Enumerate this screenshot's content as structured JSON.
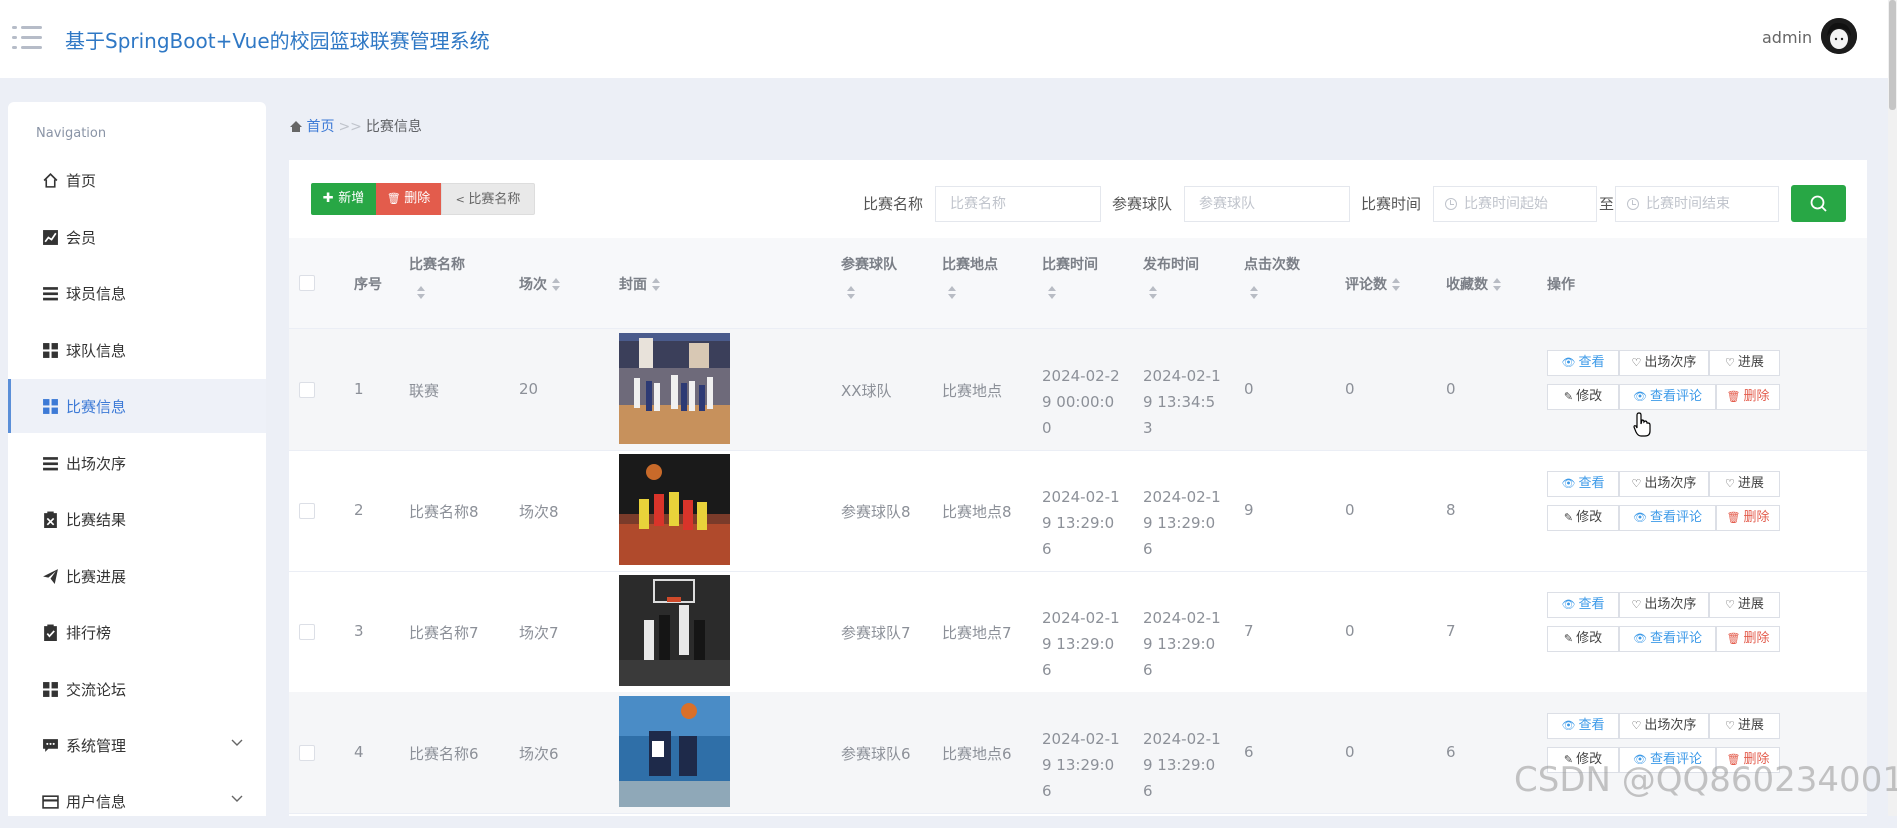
{
  "header": {
    "title": "基于SpringBoot+Vue的校园篮球联赛管理系统",
    "user": "admin"
  },
  "sidebar": {
    "title": "Navigation",
    "items": [
      {
        "label": "首页",
        "icon": "home-icon"
      },
      {
        "label": "会员",
        "icon": "chart-icon"
      },
      {
        "label": "球员信息",
        "icon": "list-icon"
      },
      {
        "label": "球队信息",
        "icon": "grid-icon"
      },
      {
        "label": "比赛信息",
        "icon": "grid-icon"
      },
      {
        "label": "出场次序",
        "icon": "list-icon"
      },
      {
        "label": "比赛结果",
        "icon": "clipboard-x-icon"
      },
      {
        "label": "比赛进展",
        "icon": "paper-plane-icon"
      },
      {
        "label": "排行榜",
        "icon": "clipboard-check-icon"
      },
      {
        "label": "交流论坛",
        "icon": "grid-icon"
      },
      {
        "label": "系统管理",
        "icon": "chat-icon"
      },
      {
        "label": "用户信息",
        "icon": "card-icon"
      }
    ]
  },
  "breadcrumb": {
    "home": "首页",
    "sep": ">>",
    "current": "比赛信息"
  },
  "toolbar": {
    "add": "新增",
    "delete": "删除",
    "share": "比赛名称"
  },
  "search": {
    "name_label": "比赛名称",
    "name_placeholder": "比赛名称",
    "team_label": "参赛球队",
    "team_placeholder": "参赛球队",
    "time_label": "比赛时间",
    "time_start_placeholder": "比赛时间起始",
    "to": "至",
    "time_end_placeholder": "比赛时间结束"
  },
  "table": {
    "headers": {
      "index": "序号",
      "name": "比赛名称",
      "round": "场次",
      "cover": "封面",
      "team": "参赛球队",
      "place": "比赛地点",
      "time": "比赛时间",
      "publish": "发布时间",
      "clicks": "点击次数",
      "comments": "评论数",
      "favorites": "收藏数",
      "actions": "操作"
    },
    "actions": {
      "view": "查看",
      "order": "出场次序",
      "progress": "进展",
      "edit": "修改",
      "view_comments": "查看评论",
      "delete": "删除"
    },
    "rows": [
      {
        "index": "1",
        "name": "联赛",
        "round": "20",
        "team": "XX球队",
        "place": "比赛地点",
        "time": "2024-02-29 00:00:00",
        "publish": "2024-02-19 13:34:53",
        "clicks": "0",
        "comments": "0",
        "favorites": "0"
      },
      {
        "index": "2",
        "name": "比赛名称8",
        "round": "场次8",
        "team": "参赛球队8",
        "place": "比赛地点8",
        "time": "2024-02-19 13:29:06",
        "publish": "2024-02-19 13:29:06",
        "clicks": "9",
        "comments": "0",
        "favorites": "8"
      },
      {
        "index": "3",
        "name": "比赛名称7",
        "round": "场次7",
        "team": "参赛球队7",
        "place": "比赛地点7",
        "time": "2024-02-19 13:29:06",
        "publish": "2024-02-19 13:29:06",
        "clicks": "7",
        "comments": "0",
        "favorites": "7"
      },
      {
        "index": "4",
        "name": "比赛名称6",
        "round": "场次6",
        "team": "参赛球队6",
        "place": "比赛地点6",
        "time": "2024-02-19 13:29:06",
        "publish": "2024-02-19 13:29:06",
        "clicks": "6",
        "comments": "0",
        "favorites": "6"
      }
    ]
  },
  "watermark": "CSDN @QQ860234001",
  "colors": {
    "primary": "#2f78c5",
    "success": "#28a745",
    "danger": "#e35c4c",
    "info": "#3d9ae8"
  }
}
